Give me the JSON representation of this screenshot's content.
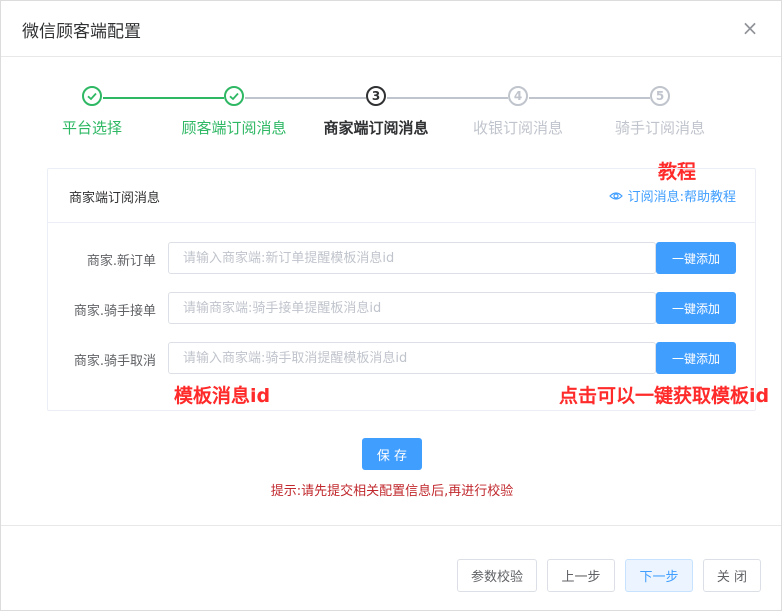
{
  "dialog": {
    "title": "微信顾客端配置",
    "close_glyph": "×"
  },
  "steps": [
    {
      "number": "1",
      "label": "平台选择",
      "state": "done"
    },
    {
      "number": "2",
      "label": "顾客端订阅消息",
      "state": "done"
    },
    {
      "number": "3",
      "label": "商家端订阅消息",
      "state": "active"
    },
    {
      "number": "4",
      "label": "收银订阅消息",
      "state": "todo"
    },
    {
      "number": "5",
      "label": "骑手订阅消息",
      "state": "todo"
    }
  ],
  "annotations": {
    "tutorial": "教程",
    "template_id": "模板消息id",
    "one_click": "点击可以一键获取模板id"
  },
  "card": {
    "title": "商家端订阅消息",
    "help_link": "订阅消息:帮助教程",
    "rows": [
      {
        "label": "商家.新订单",
        "placeholder": "请输入商家端:新订单提醒模板消息id",
        "button": "一键添加"
      },
      {
        "label": "商家.骑手接单",
        "placeholder": "请输商家端:骑手接单提醒板消息id",
        "button": "一键添加"
      },
      {
        "label": "商家.骑手取消",
        "placeholder": "请输入商家端:骑手取消提醒模板消息id",
        "button": "一键添加"
      }
    ]
  },
  "save_label": "保 存",
  "hint": "提示:请先提交相关配置信息后,再进行校验",
  "footer": {
    "verify": "参数校验",
    "prev": "上一步",
    "next": "下一步",
    "close": "关 闭"
  },
  "colors": {
    "done": "#2fb864",
    "primary": "#409eff",
    "annotation": "#ff2a2a",
    "hint": "#c0282d"
  }
}
